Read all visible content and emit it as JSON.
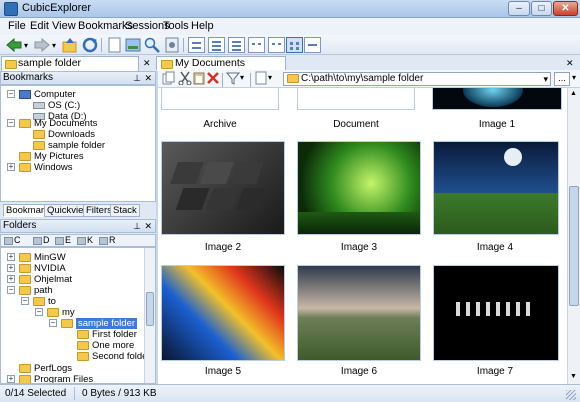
{
  "window": {
    "title": "CubicExplorer"
  },
  "menu": [
    "File",
    "Edit",
    "View",
    "Bookmarks",
    "Sessions",
    "Tools",
    "Help"
  ],
  "left_tab": {
    "label": "sample folder"
  },
  "bookmarks_panel": {
    "header": "Bookmarks",
    "items": [
      {
        "label": "Computer"
      },
      {
        "label": "OS (C:)"
      },
      {
        "label": "Data (D:)"
      },
      {
        "label": "My Documents"
      },
      {
        "label": "Downloads"
      },
      {
        "label": "sample folder"
      },
      {
        "label": "My Pictures"
      },
      {
        "label": "Windows"
      }
    ],
    "tabs": [
      "Bookmarks",
      "Quickview",
      "Filters",
      "Stack"
    ]
  },
  "folders_panel": {
    "header": "Folders",
    "drives": [
      "C",
      "D",
      "E",
      "K",
      "R"
    ],
    "items": [
      {
        "label": "MinGW"
      },
      {
        "label": "NVIDIA"
      },
      {
        "label": "Ohjelmat"
      },
      {
        "label": "path"
      },
      {
        "label": "to"
      },
      {
        "label": "my"
      },
      {
        "label": "sample folder"
      },
      {
        "label": "First folder"
      },
      {
        "label": "One more"
      },
      {
        "label": "Second folder"
      },
      {
        "label": "PerfLogs"
      },
      {
        "label": "Program Files"
      }
    ]
  },
  "doc_tab": {
    "label": "My Documents"
  },
  "address": {
    "path": "C:\\path\\to\\my\\sample folder",
    "go": "..."
  },
  "files": [
    {
      "name": "Archive"
    },
    {
      "name": "Document"
    },
    {
      "name": "Image 1"
    },
    {
      "name": "Image 2"
    },
    {
      "name": "Image 3"
    },
    {
      "name": "Image 4"
    },
    {
      "name": "Image 5"
    },
    {
      "name": "Image 6"
    },
    {
      "name": "Image 7"
    }
  ],
  "status": {
    "selected": "0/14 Selected",
    "size": "0 Bytes / 913 KB"
  },
  "colors": {
    "accent": "#3d7bd6",
    "folder": "#f2c94c",
    "selection": "#3d7bd6"
  }
}
